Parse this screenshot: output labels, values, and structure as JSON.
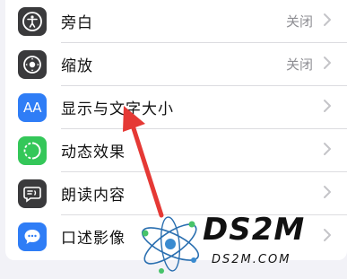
{
  "settings": {
    "items": [
      {
        "label": "旁白",
        "value": "关闭",
        "icon": "accessibility-person-icon",
        "icon_color": "#3a3a3c"
      },
      {
        "label": "缩放",
        "value": "关闭",
        "icon": "zoom-circle-icon",
        "icon_color": "#3a3a3c"
      },
      {
        "label": "显示与文字大小",
        "value": "",
        "icon": "text-size-aa-icon",
        "icon_color": "#2f7df6"
      },
      {
        "label": "动态效果",
        "value": "",
        "icon": "motion-circle-icon",
        "icon_color": "#34c759"
      },
      {
        "label": "朗读内容",
        "value": "",
        "icon": "speech-bubble-icon",
        "icon_color": "#3a3a3c"
      },
      {
        "label": "口述影像",
        "value": "",
        "icon": "audio-description-icon",
        "icon_color": "#2f7df6"
      }
    ],
    "aa_glyph": "AA"
  },
  "annotation": {
    "type": "arrow",
    "color": "#e53935"
  },
  "watermark": {
    "main": "DS2M",
    "sub": "DS2M.COM",
    "color": "#111111"
  }
}
